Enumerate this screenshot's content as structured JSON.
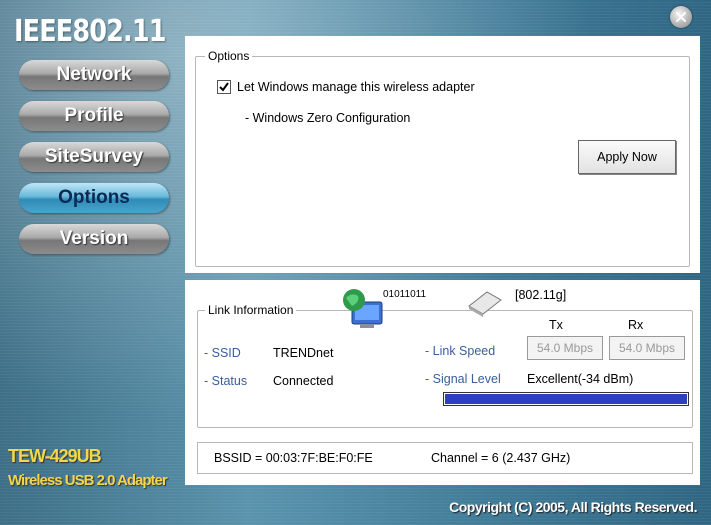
{
  "app": {
    "brand": "IEEE802.11",
    "model_line1": "TEW-429UB",
    "model_line2": "Wireless USB 2.0 Adapter",
    "copyright": "Copyright (C) 2005, All Rights Reserved."
  },
  "nav": {
    "items": [
      "Network",
      "Profile",
      "SiteSurvey",
      "Options",
      "Version"
    ],
    "active": "Options"
  },
  "options": {
    "group_label": "Options",
    "checkbox_label": "Let Windows manage this wireless adapter",
    "checkbox_checked": true,
    "subtext": "- Windows Zero Configuration",
    "apply_label": "Apply Now"
  },
  "link": {
    "group_label": "Link Information",
    "binary_text": "01011011",
    "mode": "[802.11g]",
    "ssid_label": "- SSID",
    "ssid_value": "TRENDnet",
    "status_label": "- Status",
    "status_value": "Connected",
    "link_speed_label": "- Link Speed",
    "tx_header": "Tx",
    "rx_header": "Rx",
    "tx_value": "54.0 Mbps",
    "rx_value": "54.0 Mbps",
    "signal_label": "- Signal Level",
    "signal_value": "Excellent(-34 dBm)",
    "signal_percent": 100,
    "bssid": "BSSID = 00:03:7F:BE:F0:FE",
    "channel": "Channel = 6 (2.437 GHz)"
  },
  "colors": {
    "signal": "#2e3fbf",
    "model_text": "#f2d64b"
  }
}
